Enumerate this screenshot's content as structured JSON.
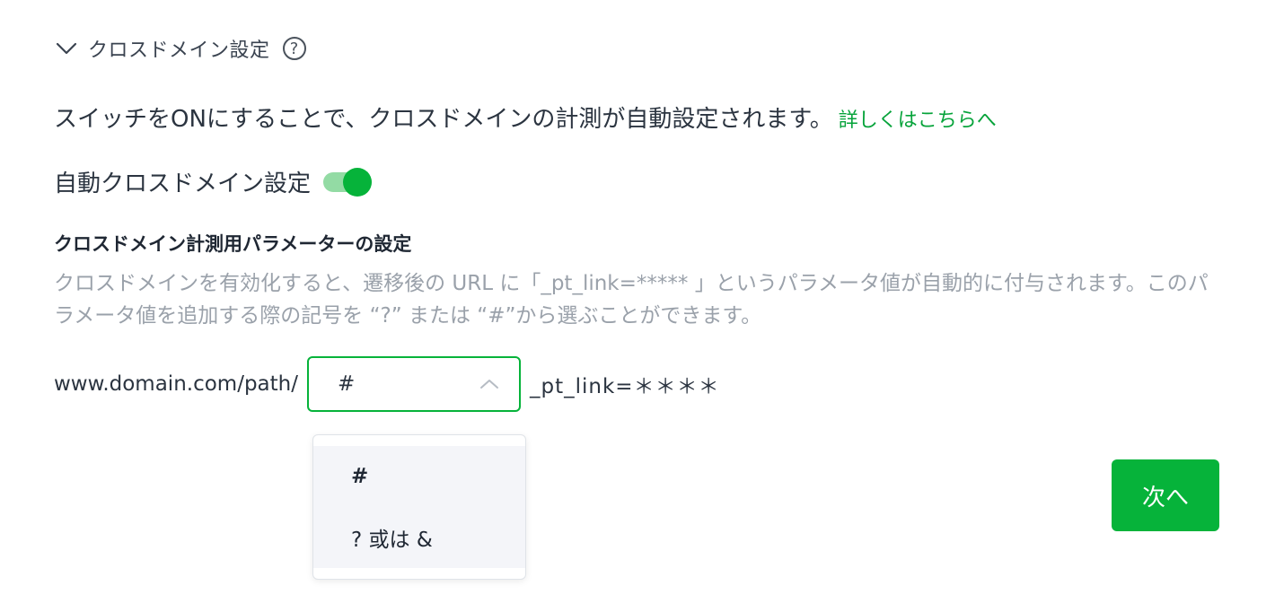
{
  "section": {
    "title": "クロスドメイン設定",
    "expand_icon": "chevron-down-icon",
    "help_icon": "question-circle-icon",
    "help_glyph": "?"
  },
  "intro": {
    "text": "スイッチをONにすることで、クロスドメインの計測が自動設定されます。",
    "link_label": "詳しくはこちらへ"
  },
  "auto_toggle": {
    "label": "自動クロスドメイン設定",
    "state": "on"
  },
  "param_section": {
    "title": "クロスドメイン計測用パラメーターの設定",
    "description": "クロスドメインを有効化すると、遷移後の URL に「_pt_link=***** 」というパラメータ値が自動的に付与されます。このパラメータ値を追加する際の記号を “?” または “#”から選ぶことができます。"
  },
  "url_builder": {
    "prefix": "www.domain.com/path/",
    "selected_symbol": "#",
    "suffix": "_pt_link=＊＊＊＊",
    "options": [
      "#",
      "? 或は &"
    ]
  },
  "next_button": {
    "label": "次へ"
  },
  "colors": {
    "accent": "#06b33a",
    "toggle_track": "#93dba4",
    "link": "#06a33a",
    "muted_text": "#9aa1aa",
    "dropdown_bg": "#f4f5f9"
  }
}
